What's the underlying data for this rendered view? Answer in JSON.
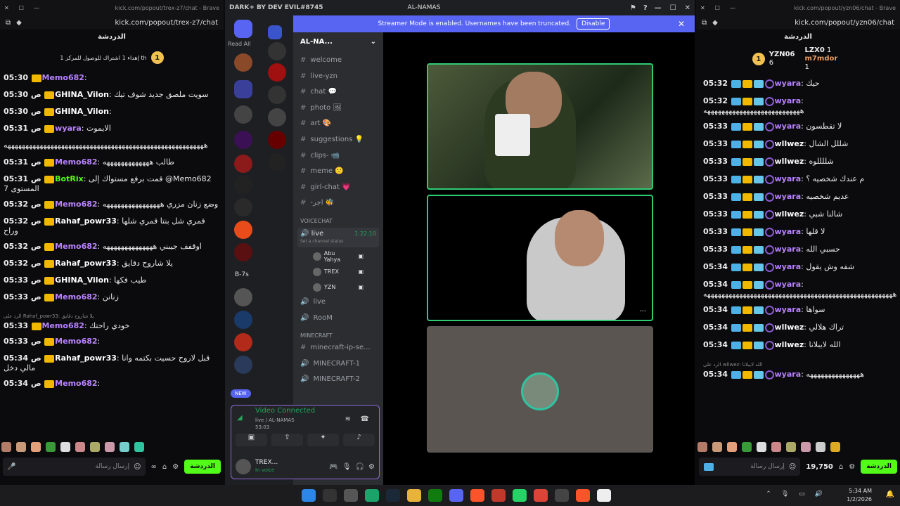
{
  "left_browser": {
    "title": "kick.com/popout/trex-z7/chat - Brave",
    "address": "kick.com/popout/trex-z7/chat",
    "chat_header": "الدردشة",
    "pinned_rank": "1",
    "pinned_text": "إهداء 1 اشتراك للوصول للمركز 1 th",
    "messages": [
      {
        "time": "05:30",
        "user": "Memo682",
        "color": "#b983ff",
        "text": ""
      },
      {
        "time": "05:30 ص",
        "user": "GHINA_Vilon",
        "color": "#ffffff",
        "text": "سويت ملصق جديد شوف تيك"
      },
      {
        "time": "05:30 ص",
        "user": "GHINA_Vilon",
        "color": "#ffffff",
        "text": ""
      },
      {
        "time": "05:31 ص",
        "user": "wyara",
        "color": "#b983ff",
        "text": "الايموت"
      },
      {
        "time": "",
        "user": "",
        "color": "#ffffff",
        "text": "ههههههههههههههههههههههههههههههههههههههههههههههههههههههههه"
      },
      {
        "time": "05:31 ص",
        "user": "Memo682",
        "color": "#b983ff",
        "text": "طالب هههههههههههههه"
      },
      {
        "time": "05:31 ص",
        "user": "BotRix",
        "color": "#53fc18",
        "text": "قمت برفع مستواك إلى @Memo682 المستوى 7"
      },
      {
        "time": "05:32 ص",
        "user": "Memo682",
        "color": "#b983ff",
        "text": "وضع زنان مزري ههههههههههههههههه"
      },
      {
        "time": "05:32 ص",
        "user": "Rahaf_powr33",
        "color": "#ffffff",
        "text": "قمري شل بنتا قمري شلها وراح"
      },
      {
        "time": "05:32 ص",
        "user": "Memo682",
        "color": "#b983ff",
        "text": "اوقفف جيبني ههههههههههههههه"
      },
      {
        "time": "05:32 ص",
        "user": "Rahaf_powr33",
        "color": "#ffffff",
        "text": "يلا شاروح دقايق"
      },
      {
        "time": "05:33 ص",
        "user": "GHINA_Vilon",
        "color": "#ffffff",
        "text": "طيب فكها"
      },
      {
        "time": "05:33 ص",
        "user": "Memo682",
        "color": "#b983ff",
        "text": "زنانن"
      },
      {
        "time": "05:33",
        "user": "Memo682",
        "color": "#b983ff",
        "text": "خودي راحتك",
        "reply": "الرد على Rahaf_powr33: يلا شاروح دقايق"
      },
      {
        "time": "05:33 ص",
        "user": "Memo682",
        "color": "#b983ff",
        "text": ""
      },
      {
        "time": "05:34 ص",
        "user": "Rahaf_powr33",
        "color": "#ffffff",
        "text": "قبل لاروح حسيت بكتمه وانا مالي دخل"
      },
      {
        "time": "05:34 ص",
        "user": "Memo682",
        "color": "#b983ff",
        "text": ""
      }
    ],
    "input_placeholder": "إرسال رسالة",
    "chat_button": "الدردشة"
  },
  "discord": {
    "window_title_left": "DARK+ BY DEV EVIL#8745",
    "window_title_center": "AL-NAMAS",
    "read_all": "Read All",
    "banner_text": "Streamer Mode is enabled. Usernames have been truncated.",
    "banner_button": "Disable",
    "server_name": "AL-NA...",
    "text_channels": [
      "welcome",
      "live-yzn",
      "chat 💬",
      "photo 🖼",
      "art 🎨",
      "suggestions 💡",
      "clips- 📹",
      "meme 🙂",
      "girl-chat 💗",
      "-اجر 🐝"
    ],
    "voice_category": "VOICECHAT",
    "voice_channel": "live",
    "voice_timer": "1:22:10",
    "voice_status": "Set a channel status",
    "voice_users": [
      "Abu Yahya",
      "TREX",
      "YZN"
    ],
    "more_voice": [
      "live",
      "RooM"
    ],
    "mc_category": "MINECRAFT",
    "mc_channels": [
      "minecraft-ip-se...",
      "MINECRAFT-1",
      "MINECRAFT-2"
    ],
    "new_badge": "NEW",
    "video_connected": "Video Connected",
    "vc_path": "live / AL-NAMAS",
    "vc_time": "53:03",
    "user_name": "TREX...",
    "user_status": "In voice",
    "server_labels": [
      "B-7s"
    ]
  },
  "right_browser": {
    "title": "kick.com/popout/yzn06/chat - Brave",
    "address": "kick.com/popout/yzn06/chat",
    "chat_header": "الدردشة",
    "pinned": [
      {
        "name": "YZN06",
        "value": "6"
      },
      {
        "name": "LZX0",
        "value": "1"
      },
      {
        "name": "m7mdor",
        "value": "1"
      }
    ],
    "pinned_rank": "1",
    "messages": [
      {
        "time": "05:32",
        "user": "wyara",
        "color": "#b983ff",
        "text": "حيك"
      },
      {
        "time": "05:32",
        "user": "wyara",
        "color": "#b983ff",
        "text": "هههههههههههههههههههههههههههه"
      },
      {
        "time": "05:33",
        "user": "wyara",
        "color": "#b983ff",
        "text": "لا تقطسون"
      },
      {
        "time": "05:33",
        "user": "wllwez",
        "color": "#ffffff",
        "text": "شللل الشال"
      },
      {
        "time": "05:33",
        "user": "wllwez",
        "color": "#ffffff",
        "text": "شللللوه"
      },
      {
        "time": "05:33",
        "user": "wyara",
        "color": "#b983ff",
        "text": "م عندك شخصيه ؟"
      },
      {
        "time": "05:33",
        "user": "wyara",
        "color": "#b983ff",
        "text": "عديم شخصيه"
      },
      {
        "time": "05:33",
        "user": "wllwez",
        "color": "#ffffff",
        "text": "شالنا شبي"
      },
      {
        "time": "05:33",
        "user": "wyara",
        "color": "#b983ff",
        "text": "لا قلها"
      },
      {
        "time": "05:33",
        "user": "wyara",
        "color": "#b983ff",
        "text": "حسبي الله"
      },
      {
        "time": "05:34",
        "user": "wyara",
        "color": "#b983ff",
        "text": "شفه وش يقول"
      },
      {
        "time": "05:34",
        "user": "wyara",
        "color": "#b983ff",
        "text": "هههههههههههههههههههههههههههههههههههههههههههههههههههههه"
      },
      {
        "time": "05:34",
        "user": "wyara",
        "color": "#b983ff",
        "text": "سواها"
      },
      {
        "time": "05:34",
        "user": "wllwez",
        "color": "#ffffff",
        "text": "تراك هلالي"
      },
      {
        "time": "05:34",
        "user": "wllwez",
        "color": "#ffffff",
        "text": "الله لايبلانا"
      },
      {
        "time": "05:34",
        "user": "wyara",
        "color": "#b983ff",
        "text": "هههههههههههههههه",
        "reply": "الرد على wllwez: الله لايبلانا"
      }
    ],
    "input_placeholder": "إرسال رسالة",
    "points": "19,750",
    "chat_button": "الدردشة"
  },
  "taskbar": {
    "time": "5:34 AM",
    "date": "1/2/2026"
  }
}
